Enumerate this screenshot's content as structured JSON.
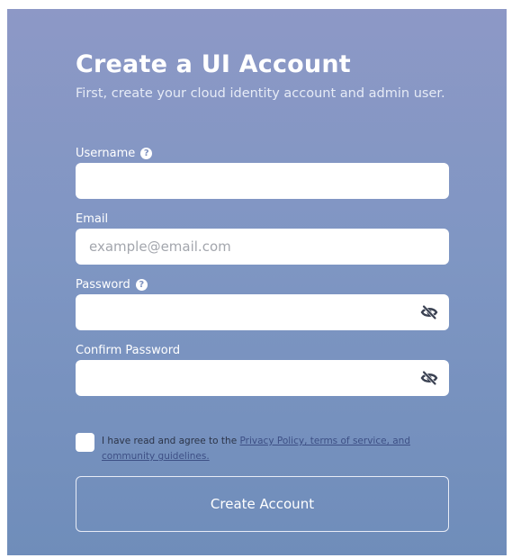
{
  "header": {
    "title": "Create a UI Account",
    "subtitle": "First, create your cloud identity account and admin user."
  },
  "fields": {
    "username": {
      "label": "Username",
      "value": "",
      "placeholder": "",
      "has_help": true
    },
    "email": {
      "label": "Email",
      "value": "",
      "placeholder": "example@email.com"
    },
    "password": {
      "label": "Password",
      "value": "",
      "placeholder": "",
      "has_help": true,
      "visibility_icon": "eye-slash-icon"
    },
    "confirm_password": {
      "label": "Confirm Password",
      "value": "",
      "placeholder": "",
      "visibility_icon": "eye-slash-icon"
    }
  },
  "help_glyph": "?",
  "agreement": {
    "checked": false,
    "text": "I have read and agree to the ",
    "link_text": "Privacy Policy, terms of service, and community guidelines."
  },
  "actions": {
    "create_label": "Create Account"
  },
  "colors": {
    "panel_top": "#8d98c6",
    "panel_bottom": "#6f8dba",
    "field_bg": "#ffffff",
    "text": "#ffffff"
  }
}
